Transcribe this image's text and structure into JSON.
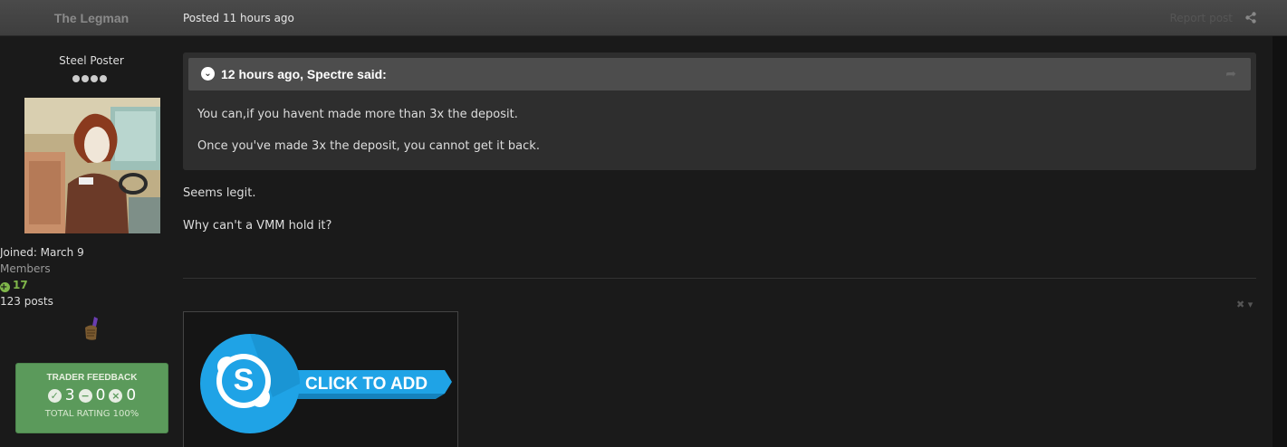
{
  "header": {
    "author": "The Legman",
    "posted_prefix": "Posted",
    "posted_time": "11 hours ago",
    "report": "Report post"
  },
  "profile": {
    "rank": "Steel Poster",
    "joined": "Joined: March 9",
    "group": "Members",
    "reputation": "17",
    "posts": "123 posts",
    "feedback": {
      "title": "TRADER FEEDBACK",
      "positive": "3",
      "neutral": "0",
      "negative": "0",
      "rating": "TOTAL RATING 100%"
    }
  },
  "quote": {
    "citation": "12 hours ago, Spectre said:",
    "lines": [
      "You can,if you havent made more than 3x the deposit.",
      "Once you've made 3x the deposit, you cannot get it back."
    ]
  },
  "post": {
    "lines": [
      "Seems legit.",
      "Why can't a VMM hold it?"
    ]
  },
  "signature": {
    "banner_text": "CLICK TO ADD"
  },
  "colors": {
    "feedback_green": "#5b9a5b",
    "reputation_green": "#7fb54a",
    "skype_blue": "#1fa3e6"
  }
}
